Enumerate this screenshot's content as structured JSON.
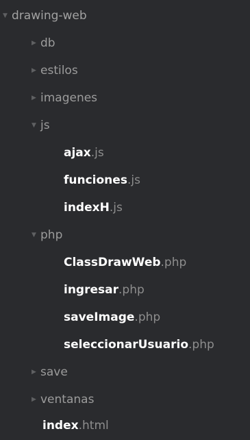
{
  "tree": {
    "root": {
      "name": "drawing-web",
      "expanded": true
    },
    "db": {
      "name": "db",
      "expanded": false
    },
    "estilos": {
      "name": "estilos",
      "expanded": false
    },
    "imagenes": {
      "name": "imagenes",
      "expanded": false
    },
    "js": {
      "name": "js",
      "expanded": true,
      "files": [
        {
          "base": "ajax",
          "ext": ".js"
        },
        {
          "base": "funciones",
          "ext": ".js"
        },
        {
          "base": "indexH",
          "ext": ".js"
        }
      ]
    },
    "php": {
      "name": "php",
      "expanded": true,
      "files": [
        {
          "base": "ClassDrawWeb",
          "ext": ".php"
        },
        {
          "base": "ingresar",
          "ext": ".php"
        },
        {
          "base": "saveImage",
          "ext": ".php"
        },
        {
          "base": "seleccionarUsuario",
          "ext": ".php"
        }
      ]
    },
    "save": {
      "name": "save",
      "expanded": false
    },
    "ventanas": {
      "name": "ventanas",
      "expanded": false
    },
    "index_file": {
      "base": "index",
      "ext": ".html"
    }
  },
  "icons": {
    "expanded": "caret-down-icon",
    "collapsed": "caret-right-icon"
  },
  "colors": {
    "background": "#2a2b2e",
    "folder_text": "#9c9c9c",
    "file_base": "#ffffff",
    "file_ext": "#8e8e8e",
    "arrow": "#5f6062"
  }
}
